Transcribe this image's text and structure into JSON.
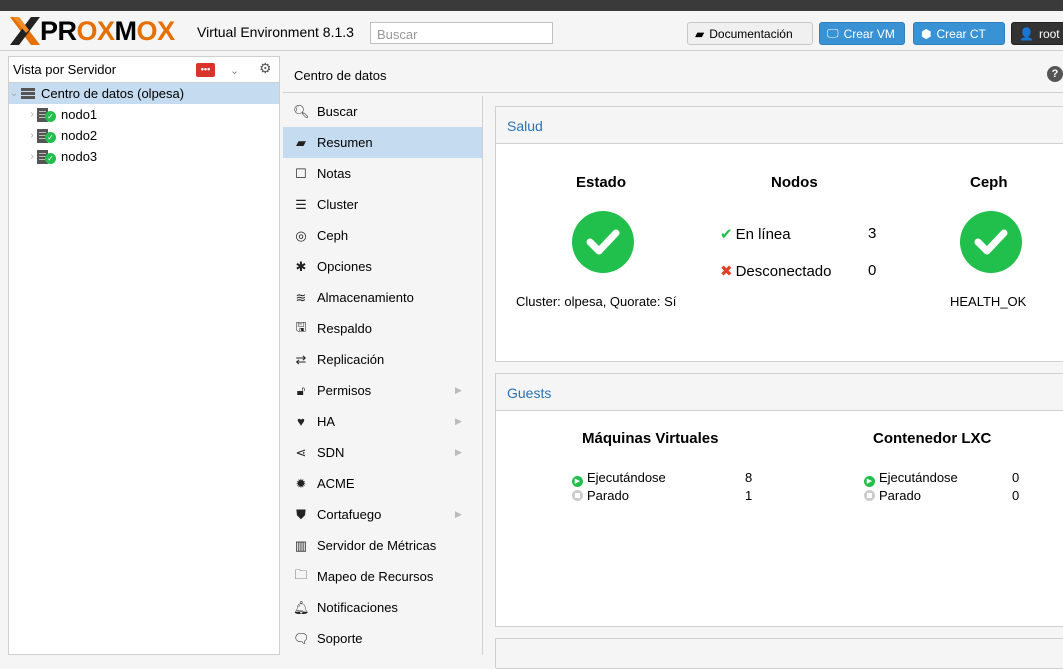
{
  "header": {
    "logo_text": "PROXMOX",
    "version": "Virtual Environment 8.1.3",
    "search_placeholder": "Buscar",
    "doc_label": "Documentación",
    "create_vm_label": "Crear VM",
    "create_ct_label": "Crear CT",
    "user_label": "root"
  },
  "left": {
    "view_label": "Vista por Servidor",
    "tree": [
      {
        "label": "Centro de datos (olpesa)"
      },
      {
        "label": "nodo1"
      },
      {
        "label": "nodo2"
      },
      {
        "label": "nodo3"
      }
    ]
  },
  "breadcrumb": "Centro de datos",
  "menu": [
    {
      "label": "Buscar",
      "icon": "search-icon"
    },
    {
      "label": "Resumen",
      "icon": "book-icon"
    },
    {
      "label": "Notas",
      "icon": "note-icon"
    },
    {
      "label": "Cluster",
      "icon": "server-icon"
    },
    {
      "label": "Ceph",
      "icon": "ceph-icon"
    },
    {
      "label": "Opciones",
      "icon": "gear-icon"
    },
    {
      "label": "Almacenamiento",
      "icon": "database-icon"
    },
    {
      "label": "Respaldo",
      "icon": "floppy-icon"
    },
    {
      "label": "Replicación",
      "icon": "retweet-icon"
    },
    {
      "label": "Permisos",
      "icon": "unlock-icon"
    },
    {
      "label": "HA",
      "icon": "heartbeat-icon"
    },
    {
      "label": "SDN",
      "icon": "sdn-icon"
    },
    {
      "label": "ACME",
      "icon": "certificate-icon"
    },
    {
      "label": "Cortafuego",
      "icon": "shield-icon"
    },
    {
      "label": "Servidor de Métricas",
      "icon": "bar-chart-icon"
    },
    {
      "label": "Mapeo de Recursos",
      "icon": "folder-icon"
    },
    {
      "label": "Notificaciones",
      "icon": "bell-icon"
    },
    {
      "label": "Soporte",
      "icon": "support-icon"
    }
  ],
  "health": {
    "title": "Salud",
    "status_title": "Estado",
    "nodes_title": "Nodos",
    "ceph_title": "Ceph",
    "online_label": "En línea",
    "online_value": "3",
    "offline_label": "Desconectado",
    "offline_value": "0",
    "cluster_text": "Cluster: olpesa, Quorate: Sí",
    "ceph_status": "HEALTH_OK"
  },
  "guests": {
    "title": "Guests",
    "vm_title": "Máquinas Virtuales",
    "lxc_title": "Contenedor LXC",
    "running_label": "Ejecutándose",
    "stopped_label": "Parado",
    "vm_running": "8",
    "vm_stopped": "1",
    "lxc_running": "0",
    "lxc_stopped": "0"
  },
  "colors": {
    "accent": "#3892d4",
    "ok": "#21bf4b",
    "error": "#e0402a",
    "selected": "#c5dbf0",
    "panel_title": "#2a72b5"
  }
}
